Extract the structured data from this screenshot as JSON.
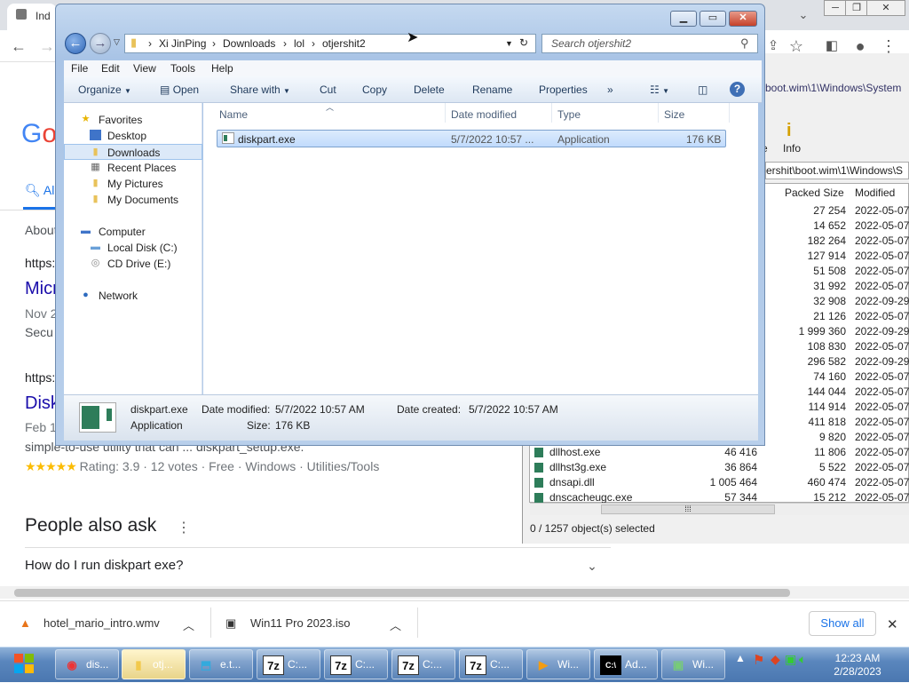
{
  "browser": {
    "tab_title": "Ind",
    "search_tab": "Al",
    "results": [
      {
        "url": "https:",
        "title": "Micr",
        "date": "Nov 2",
        "snippet": "Secu"
      },
      {
        "url": "https:",
        "title": "Disk",
        "date": "Feb 1",
        "snippet": "simple-to-use utility that can ... diskpart_setup.exe."
      }
    ],
    "about": "About",
    "rating_text": "Rating: 3.9 · 12 votes · Free · Windows · Utilities/Tools",
    "stars": "★★★★★",
    "paa_title": "People also ask",
    "paa_question": "How do I run diskpart exe?"
  },
  "downloads": {
    "items": [
      "hotel_mario_intro.wmv",
      "Win11 Pro 2023.iso"
    ],
    "show_all": "Show all"
  },
  "sevenzip": {
    "address": "boot.wim\\1\\Windows\\System",
    "info_label": "Info",
    "info_partial": "e",
    "path": "ershit\\boot.wim\\1\\Windows\\S",
    "col_packed": "Packed Size",
    "col_modified": "Modified",
    "rows": [
      {
        "name": "",
        "size": "",
        "packed": "27 254",
        "modified": "2022-05-07"
      },
      {
        "name": "",
        "size": "",
        "packed": "14 652",
        "modified": "2022-05-07"
      },
      {
        "name": "",
        "size": "",
        "packed": "182 264",
        "modified": "2022-05-07"
      },
      {
        "name": "",
        "size": "",
        "packed": "127 914",
        "modified": "2022-05-07"
      },
      {
        "name": "",
        "size": "",
        "packed": "51 508",
        "modified": "2022-05-07"
      },
      {
        "name": "",
        "size": "",
        "packed": "31 992",
        "modified": "2022-05-07"
      },
      {
        "name": "",
        "size": "",
        "packed": "32 908",
        "modified": "2022-09-29"
      },
      {
        "name": "",
        "size": "",
        "packed": "21 126",
        "modified": "2022-05-07"
      },
      {
        "name": "",
        "size": "",
        "packed": "1 999 360",
        "modified": "2022-09-29"
      },
      {
        "name": "",
        "size": "",
        "packed": "108 830",
        "modified": "2022-05-07"
      },
      {
        "name": "",
        "size": "",
        "packed": "296 582",
        "modified": "2022-09-29"
      },
      {
        "name": "",
        "size": "",
        "packed": "74 160",
        "modified": "2022-05-07"
      },
      {
        "name": "",
        "size": "",
        "packed": "144 044",
        "modified": "2022-05-07"
      },
      {
        "name": "",
        "size": "",
        "packed": "114 914",
        "modified": "2022-05-07"
      },
      {
        "name": "",
        "size": "",
        "packed": "411 818",
        "modified": "2022-05-07"
      },
      {
        "name": "",
        "size": "",
        "packed": "9 820",
        "modified": "2022-05-07"
      },
      {
        "name": "dllhost.exe",
        "size": "46 416",
        "packed": "11 806",
        "modified": "2022-05-07"
      },
      {
        "name": "dllhst3g.exe",
        "size": "36 864",
        "packed": "5 522",
        "modified": "2022-05-07"
      },
      {
        "name": "dnsapi.dll",
        "size": "1 005 464",
        "packed": "460 474",
        "modified": "2022-05-07"
      },
      {
        "name": "dnscacheugc.exe",
        "size": "57 344",
        "packed": "15 212",
        "modified": "2022-05-07"
      }
    ],
    "status": "0 / 1257 object(s) selected"
  },
  "explorer": {
    "breadcrumb": [
      "Xi JinPing",
      "Downloads",
      "lol",
      "otjershit2"
    ],
    "search_placeholder": "Search otjershit2",
    "menu": [
      "File",
      "Edit",
      "View",
      "Tools",
      "Help"
    ],
    "commands": [
      "Organize",
      "Open",
      "Share with",
      "Cut",
      "Copy",
      "Delete",
      "Rename",
      "Properties"
    ],
    "nav": {
      "favorites": "Favorites",
      "fav_items": [
        "Desktop",
        "Downloads",
        "Recent Places",
        "My Pictures",
        "My Documents"
      ],
      "computer": "Computer",
      "drives": [
        "Local Disk (C:)",
        "CD Drive (E:)"
      ],
      "network": "Network"
    },
    "columns": [
      "Name",
      "Date modified",
      "Type",
      "Size"
    ],
    "file": {
      "name": "diskpart.exe",
      "date": "5/7/2022 10:57 ...",
      "type": "Application",
      "size": "176 KB"
    },
    "details": {
      "name": "diskpart.exe",
      "type": "Application",
      "date_modified_label": "Date modified:",
      "date_modified": "5/7/2022 10:57 AM",
      "date_created_label": "Date created:",
      "date_created": "5/7/2022 10:57 AM",
      "size_label": "Size:",
      "size": "176 KB"
    }
  },
  "taskbar": {
    "buttons": [
      {
        "icon": "chrome-icon",
        "label": "dis..."
      },
      {
        "icon": "folder-icon",
        "label": "otj..."
      },
      {
        "icon": "network-icon",
        "label": "e.t..."
      },
      {
        "icon": "7z-icon",
        "label": "C:..."
      },
      {
        "icon": "7z-icon",
        "label": "C:..."
      },
      {
        "icon": "7z-icon",
        "label": "C:..."
      },
      {
        "icon": "7z-icon",
        "label": "C:..."
      },
      {
        "icon": "media-icon",
        "label": "Wi..."
      },
      {
        "icon": "cmd-icon",
        "label": "Ad..."
      },
      {
        "icon": "monitor-icon",
        "label": "Wi..."
      }
    ],
    "time": "12:23 AM",
    "date": "2/28/2023"
  }
}
